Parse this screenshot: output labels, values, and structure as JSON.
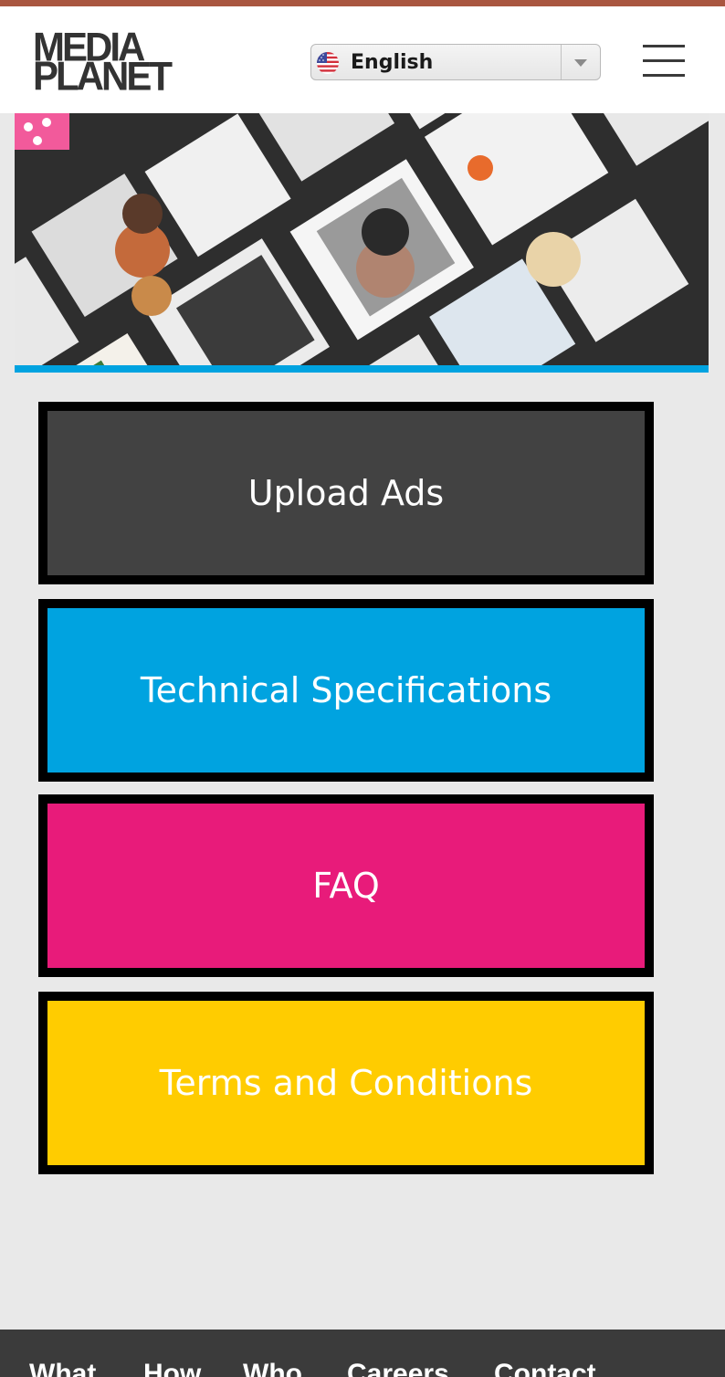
{
  "colors": {
    "top_bar": "#a95640",
    "header_bg": "#ffffff",
    "page_bg": "#e9e9e9",
    "hero_underline": "#00a3e0",
    "footer_bg": "#3b3b3b"
  },
  "header": {
    "logo_line1": "MEDIA",
    "logo_line2": "PLANET",
    "language": {
      "selected": "English",
      "flag_icon": "us-flag-icon",
      "arrow_icon": "chevron-down-icon"
    },
    "menu_icon": "hamburger-menu-icon"
  },
  "hero": {
    "image": "magazine-covers-collage"
  },
  "menu_buttons": [
    {
      "label": "Upload Ads",
      "color": "#424242"
    },
    {
      "label": "Technical Specifications",
      "color": "#00a3e0"
    },
    {
      "label": "FAQ",
      "color": "#e81b7a"
    },
    {
      "label": "Terms and Conditions",
      "color": "#ffcc00"
    }
  ],
  "footer": {
    "links": [
      "What",
      "How",
      "Who",
      "Careers",
      "Contact"
    ]
  }
}
